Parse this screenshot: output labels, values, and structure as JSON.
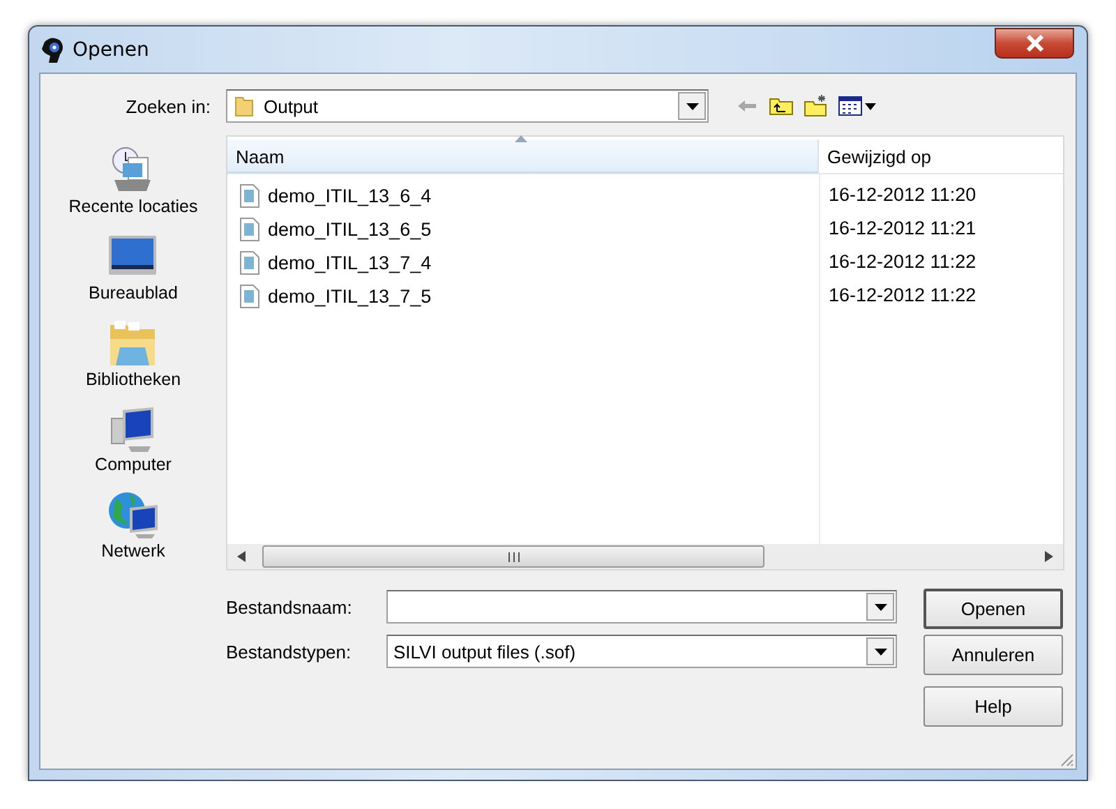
{
  "window": {
    "title": "Openen"
  },
  "look_in": {
    "label": "Zoeken in:",
    "value": "Output"
  },
  "places": [
    {
      "kind": "recent",
      "label": "Recente locaties"
    },
    {
      "kind": "desktop",
      "label": "Bureaublad"
    },
    {
      "kind": "libraries",
      "label": "Bibliotheken"
    },
    {
      "kind": "computer",
      "label": "Computer"
    },
    {
      "kind": "network",
      "label": "Netwerk"
    }
  ],
  "columns": [
    {
      "label": "Naam",
      "sorted": true
    },
    {
      "label": "Gewijzigd op",
      "sorted": false
    }
  ],
  "files": [
    {
      "name": "demo_ITIL_13_6_4",
      "modified": "16-12-2012 11:20"
    },
    {
      "name": "demo_ITIL_13_6_5",
      "modified": "16-12-2012 11:21"
    },
    {
      "name": "demo_ITIL_13_7_4",
      "modified": "16-12-2012 11:22"
    },
    {
      "name": "demo_ITIL_13_7_5",
      "modified": "16-12-2012 11:22"
    }
  ],
  "file_name": {
    "label": "Bestandsnaam:"
  },
  "file_type": {
    "label": "Bestandstypen:",
    "value": "SILVI output files (.sof)"
  },
  "buttons": [
    {
      "label": "Openen",
      "default": true
    },
    {
      "label": "Annuleren",
      "default": false
    },
    {
      "label": "Help",
      "default": false
    }
  ]
}
